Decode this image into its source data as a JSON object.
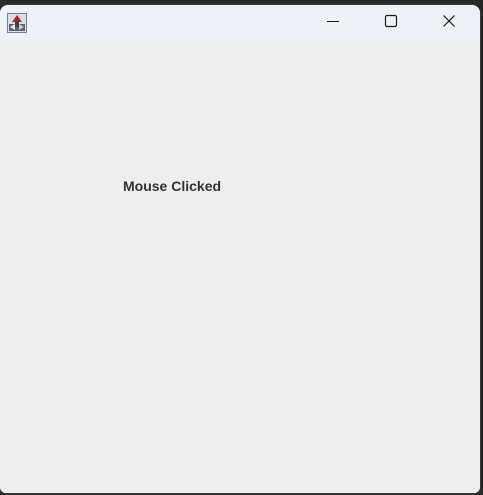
{
  "window": {
    "title": "",
    "app_icon": "java-app-icon",
    "controls": {
      "minimize_icon": "minimize-icon",
      "maximize_icon": "maximize-icon",
      "close_icon": "close-icon"
    }
  },
  "content": {
    "status_text": "Mouse Clicked"
  },
  "colors": {
    "titlebar": "#eef2f7",
    "content_bg": "#eeeeee",
    "text": "#333333"
  }
}
